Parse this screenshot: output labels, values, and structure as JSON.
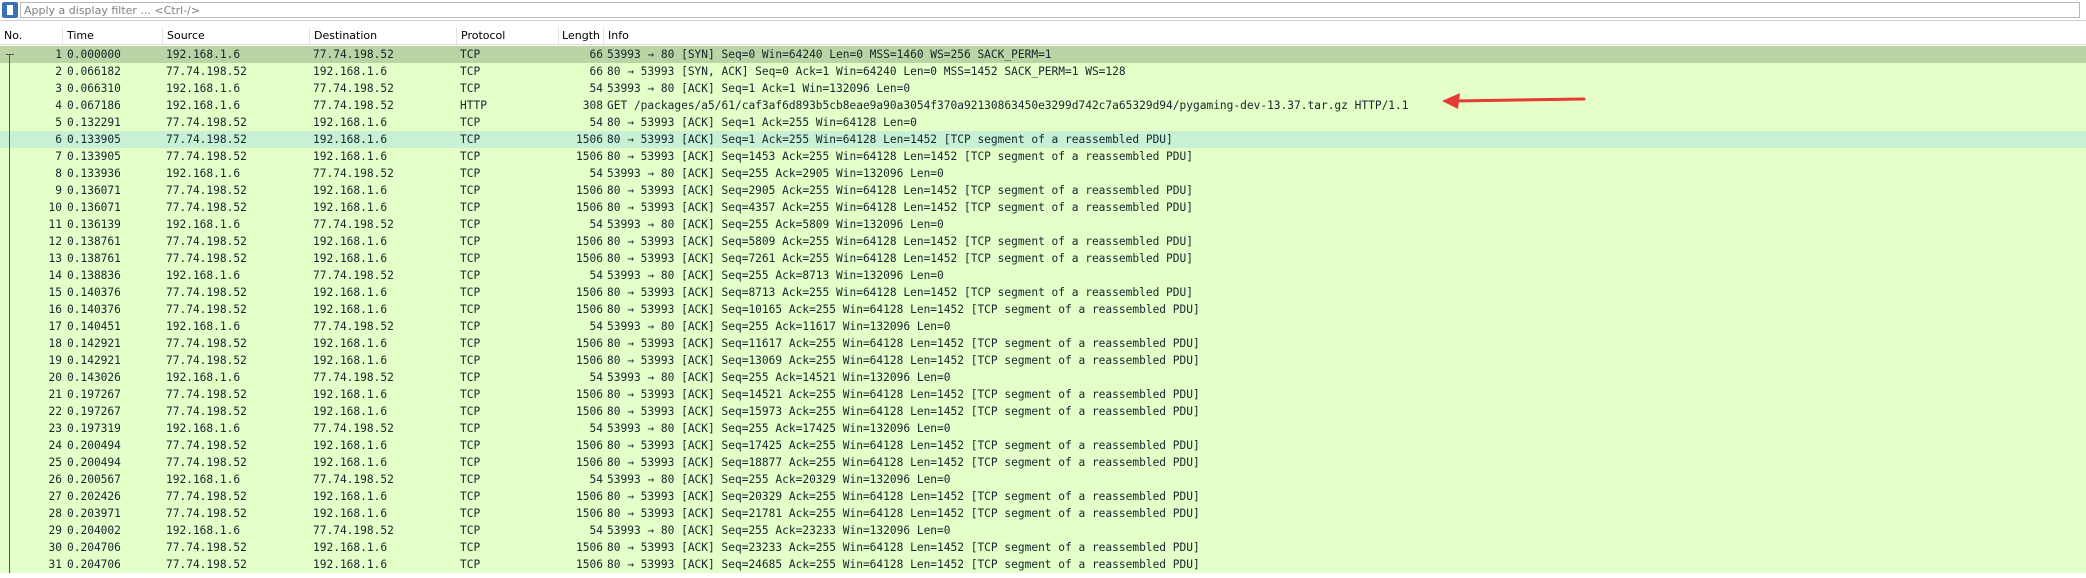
{
  "filter": {
    "placeholder": "Apply a display filter ... <Ctrl-/>"
  },
  "columns": {
    "no": "No.",
    "time": "Time",
    "source": "Source",
    "destination": "Destination",
    "protocol": "Protocol",
    "length": "Length",
    "info": "Info"
  },
  "colors": {
    "row_default": "#e4ffc7",
    "row_first_selected": "#bcd3a6",
    "row_highlight": "#c8f0d4",
    "text": "#12272e",
    "arrow": "#e63b34"
  },
  "packets": [
    {
      "no": "1",
      "time": "0.000000",
      "src": "192.168.1.6",
      "dst": "77.74.198.52",
      "proto": "TCP",
      "len": "66",
      "info": "53993 → 80 [SYN] Seq=0 Win=64240 Len=0 MSS=1460 WS=256 SACK_PERM=1",
      "style": "first"
    },
    {
      "no": "2",
      "time": "0.066182",
      "src": "77.74.198.52",
      "dst": "192.168.1.6",
      "proto": "TCP",
      "len": "66",
      "info": "80 → 53993 [SYN, ACK] Seq=0 Ack=1 Win=64240 Len=0 MSS=1452 SACK_PERM=1 WS=128",
      "style": "default"
    },
    {
      "no": "3",
      "time": "0.066310",
      "src": "192.168.1.6",
      "dst": "77.74.198.52",
      "proto": "TCP",
      "len": "54",
      "info": "53993 → 80 [ACK] Seq=1 Ack=1 Win=132096 Len=0",
      "style": "default"
    },
    {
      "no": "4",
      "time": "0.067186",
      "src": "192.168.1.6",
      "dst": "77.74.198.52",
      "proto": "HTTP",
      "len": "308",
      "info": "GET /packages/a5/61/caf3af6d893b5cb8eae9a90a3054f370a92130863450e3299d742c7a65329d94/pygaming-dev-13.37.tar.gz HTTP/1.1",
      "style": "default"
    },
    {
      "no": "5",
      "time": "0.132291",
      "src": "77.74.198.52",
      "dst": "192.168.1.6",
      "proto": "TCP",
      "len": "54",
      "info": "80 → 53993 [ACK] Seq=1 Ack=255 Win=64128 Len=0",
      "style": "default"
    },
    {
      "no": "6",
      "time": "0.133905",
      "src": "77.74.198.52",
      "dst": "192.168.1.6",
      "proto": "TCP",
      "len": "1506",
      "info": "80 → 53993 [ACK] Seq=1 Ack=255 Win=64128 Len=1452 [TCP segment of a reassembled PDU]",
      "style": "highlight"
    },
    {
      "no": "7",
      "time": "0.133905",
      "src": "77.74.198.52",
      "dst": "192.168.1.6",
      "proto": "TCP",
      "len": "1506",
      "info": "80 → 53993 [ACK] Seq=1453 Ack=255 Win=64128 Len=1452 [TCP segment of a reassembled PDU]",
      "style": "default"
    },
    {
      "no": "8",
      "time": "0.133936",
      "src": "192.168.1.6",
      "dst": "77.74.198.52",
      "proto": "TCP",
      "len": "54",
      "info": "53993 → 80 [ACK] Seq=255 Ack=2905 Win=132096 Len=0",
      "style": "default"
    },
    {
      "no": "9",
      "time": "0.136071",
      "src": "77.74.198.52",
      "dst": "192.168.1.6",
      "proto": "TCP",
      "len": "1506",
      "info": "80 → 53993 [ACK] Seq=2905 Ack=255 Win=64128 Len=1452 [TCP segment of a reassembled PDU]",
      "style": "default"
    },
    {
      "no": "10",
      "time": "0.136071",
      "src": "77.74.198.52",
      "dst": "192.168.1.6",
      "proto": "TCP",
      "len": "1506",
      "info": "80 → 53993 [ACK] Seq=4357 Ack=255 Win=64128 Len=1452 [TCP segment of a reassembled PDU]",
      "style": "default"
    },
    {
      "no": "11",
      "time": "0.136139",
      "src": "192.168.1.6",
      "dst": "77.74.198.52",
      "proto": "TCP",
      "len": "54",
      "info": "53993 → 80 [ACK] Seq=255 Ack=5809 Win=132096 Len=0",
      "style": "default"
    },
    {
      "no": "12",
      "time": "0.138761",
      "src": "77.74.198.52",
      "dst": "192.168.1.6",
      "proto": "TCP",
      "len": "1506",
      "info": "80 → 53993 [ACK] Seq=5809 Ack=255 Win=64128 Len=1452 [TCP segment of a reassembled PDU]",
      "style": "default"
    },
    {
      "no": "13",
      "time": "0.138761",
      "src": "77.74.198.52",
      "dst": "192.168.1.6",
      "proto": "TCP",
      "len": "1506",
      "info": "80 → 53993 [ACK] Seq=7261 Ack=255 Win=64128 Len=1452 [TCP segment of a reassembled PDU]",
      "style": "default"
    },
    {
      "no": "14",
      "time": "0.138836",
      "src": "192.168.1.6",
      "dst": "77.74.198.52",
      "proto": "TCP",
      "len": "54",
      "info": "53993 → 80 [ACK] Seq=255 Ack=8713 Win=132096 Len=0",
      "style": "default"
    },
    {
      "no": "15",
      "time": "0.140376",
      "src": "77.74.198.52",
      "dst": "192.168.1.6",
      "proto": "TCP",
      "len": "1506",
      "info": "80 → 53993 [ACK] Seq=8713 Ack=255 Win=64128 Len=1452 [TCP segment of a reassembled PDU]",
      "style": "default"
    },
    {
      "no": "16",
      "time": "0.140376",
      "src": "77.74.198.52",
      "dst": "192.168.1.6",
      "proto": "TCP",
      "len": "1506",
      "info": "80 → 53993 [ACK] Seq=10165 Ack=255 Win=64128 Len=1452 [TCP segment of a reassembled PDU]",
      "style": "default"
    },
    {
      "no": "17",
      "time": "0.140451",
      "src": "192.168.1.6",
      "dst": "77.74.198.52",
      "proto": "TCP",
      "len": "54",
      "info": "53993 → 80 [ACK] Seq=255 Ack=11617 Win=132096 Len=0",
      "style": "default"
    },
    {
      "no": "18",
      "time": "0.142921",
      "src": "77.74.198.52",
      "dst": "192.168.1.6",
      "proto": "TCP",
      "len": "1506",
      "info": "80 → 53993 [ACK] Seq=11617 Ack=255 Win=64128 Len=1452 [TCP segment of a reassembled PDU]",
      "style": "default"
    },
    {
      "no": "19",
      "time": "0.142921",
      "src": "77.74.198.52",
      "dst": "192.168.1.6",
      "proto": "TCP",
      "len": "1506",
      "info": "80 → 53993 [ACK] Seq=13069 Ack=255 Win=64128 Len=1452 [TCP segment of a reassembled PDU]",
      "style": "default"
    },
    {
      "no": "20",
      "time": "0.143026",
      "src": "192.168.1.6",
      "dst": "77.74.198.52",
      "proto": "TCP",
      "len": "54",
      "info": "53993 → 80 [ACK] Seq=255 Ack=14521 Win=132096 Len=0",
      "style": "default"
    },
    {
      "no": "21",
      "time": "0.197267",
      "src": "77.74.198.52",
      "dst": "192.168.1.6",
      "proto": "TCP",
      "len": "1506",
      "info": "80 → 53993 [ACK] Seq=14521 Ack=255 Win=64128 Len=1452 [TCP segment of a reassembled PDU]",
      "style": "default"
    },
    {
      "no": "22",
      "time": "0.197267",
      "src": "77.74.198.52",
      "dst": "192.168.1.6",
      "proto": "TCP",
      "len": "1506",
      "info": "80 → 53993 [ACK] Seq=15973 Ack=255 Win=64128 Len=1452 [TCP segment of a reassembled PDU]",
      "style": "default"
    },
    {
      "no": "23",
      "time": "0.197319",
      "src": "192.168.1.6",
      "dst": "77.74.198.52",
      "proto": "TCP",
      "len": "54",
      "info": "53993 → 80 [ACK] Seq=255 Ack=17425 Win=132096 Len=0",
      "style": "default"
    },
    {
      "no": "24",
      "time": "0.200494",
      "src": "77.74.198.52",
      "dst": "192.168.1.6",
      "proto": "TCP",
      "len": "1506",
      "info": "80 → 53993 [ACK] Seq=17425 Ack=255 Win=64128 Len=1452 [TCP segment of a reassembled PDU]",
      "style": "default"
    },
    {
      "no": "25",
      "time": "0.200494",
      "src": "77.74.198.52",
      "dst": "192.168.1.6",
      "proto": "TCP",
      "len": "1506",
      "info": "80 → 53993 [ACK] Seq=18877 Ack=255 Win=64128 Len=1452 [TCP segment of a reassembled PDU]",
      "style": "default"
    },
    {
      "no": "26",
      "time": "0.200567",
      "src": "192.168.1.6",
      "dst": "77.74.198.52",
      "proto": "TCP",
      "len": "54",
      "info": "53993 → 80 [ACK] Seq=255 Ack=20329 Win=132096 Len=0",
      "style": "default"
    },
    {
      "no": "27",
      "time": "0.202426",
      "src": "77.74.198.52",
      "dst": "192.168.1.6",
      "proto": "TCP",
      "len": "1506",
      "info": "80 → 53993 [ACK] Seq=20329 Ack=255 Win=64128 Len=1452 [TCP segment of a reassembled PDU]",
      "style": "default"
    },
    {
      "no": "28",
      "time": "0.203971",
      "src": "77.74.198.52",
      "dst": "192.168.1.6",
      "proto": "TCP",
      "len": "1506",
      "info": "80 → 53993 [ACK] Seq=21781 Ack=255 Win=64128 Len=1452 [TCP segment of a reassembled PDU]",
      "style": "default"
    },
    {
      "no": "29",
      "time": "0.204002",
      "src": "192.168.1.6",
      "dst": "77.74.198.52",
      "proto": "TCP",
      "len": "54",
      "info": "53993 → 80 [ACK] Seq=255 Ack=23233 Win=132096 Len=0",
      "style": "default"
    },
    {
      "no": "30",
      "time": "0.204706",
      "src": "77.74.198.52",
      "dst": "192.168.1.6",
      "proto": "TCP",
      "len": "1506",
      "info": "80 → 53993 [ACK] Seq=23233 Ack=255 Win=64128 Len=1452 [TCP segment of a reassembled PDU]",
      "style": "default"
    },
    {
      "no": "31",
      "time": "0.204706",
      "src": "77.74.198.52",
      "dst": "192.168.1.6",
      "proto": "TCP",
      "len": "1506",
      "info": "80 → 53993 [ACK] Seq=24685 Ack=255 Win=64128 Len=1452 [TCP segment of a reassembled PDU]",
      "style": "default"
    }
  ]
}
